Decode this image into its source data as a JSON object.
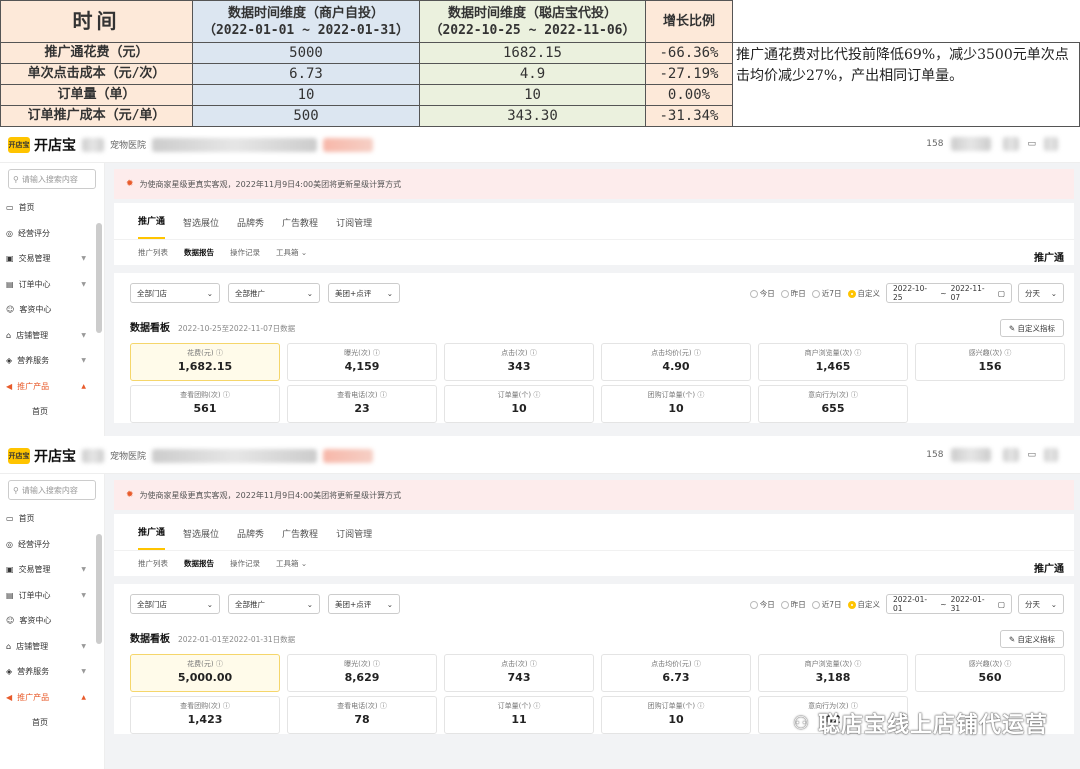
{
  "comparison": {
    "headers": [
      "时间",
      "数据时间维度（商户自投）\n（2022-01-01 ~ 2022-01-31）",
      "数据时间维度（聪店宝代投）\n（2022-10-25 ~ 2022-11-06）",
      "增长比例"
    ],
    "rows": [
      {
        "label": "推广通花费（元）",
        "self": "5000",
        "agency": "1682.15",
        "growth": "-66.36%"
      },
      {
        "label": "单次点击成本（元/次）",
        "self": "6.73",
        "agency": "4.9",
        "growth": "-27.19%"
      },
      {
        "label": "订单量（单）",
        "self": "10",
        "agency": "10",
        "growth": "0.00%"
      },
      {
        "label": "订单推广成本（元/单）",
        "self": "500",
        "agency": "343.30",
        "growth": "-31.34%"
      }
    ],
    "note": "推广通花费对比代投前降低69%，减少3500元单次点击均价减少27%，产出相同订单量。"
  },
  "common": {
    "logo_mark": "开店宝",
    "logo_text": "开店宝",
    "store_suffix": "宠物医院",
    "phone_prefix": "158",
    "search_placeholder": "请输入搜索内容",
    "notice": "为使商家星级更真实客观，2022年11月9日4:00美团将更新星级计算方式",
    "nav": [
      "首页",
      "经营评分",
      "交易管理",
      "订单中心",
      "客资中心",
      "店铺管理",
      "营养服务",
      "推广产品",
      "首页"
    ],
    "tabs": [
      "推广通",
      "智选展位",
      "品牌秀",
      "广告教程",
      "订阅管理"
    ],
    "subtabs": [
      "推广列表",
      "数据报告",
      "操作记录",
      "工具箱"
    ],
    "section_title": "推广通",
    "filters": [
      "全部门店",
      "全部推广",
      "美团+点评"
    ],
    "radios": [
      "今日",
      "昨日",
      "近7日",
      "自定义"
    ],
    "granularity": "分天",
    "board_title": "数据看板",
    "custom_btn": "自定义指标",
    "metric_labels": [
      "花费(元)",
      "曝光(次)",
      "点击(次)",
      "点击均价(元)",
      "商户浏览量(次)",
      "感兴趣(次)",
      "查看团购(次)",
      "查看电话(次)",
      "订单量(个)",
      "团购订单量(个)",
      "意向行为(次)"
    ]
  },
  "shot1": {
    "date_from": "2022-10-25",
    "date_to": "2022-11-07",
    "range_text": "2022-10-25至2022-11-07日数据",
    "values": [
      "1,682.15",
      "4,159",
      "343",
      "4.90",
      "1,465",
      "156",
      "561",
      "23",
      "10",
      "10",
      "655"
    ]
  },
  "shot2": {
    "date_from": "2022-01-01",
    "date_to": "2022-01-31",
    "range_text": "2022-01-01至2022-01-31日数据",
    "values": [
      "5,000.00",
      "8,629",
      "743",
      "6.73",
      "3,188",
      "560",
      "1,423",
      "78",
      "11",
      "10",
      "62"
    ]
  },
  "watermark": "聪店宝线上店铺代运营"
}
